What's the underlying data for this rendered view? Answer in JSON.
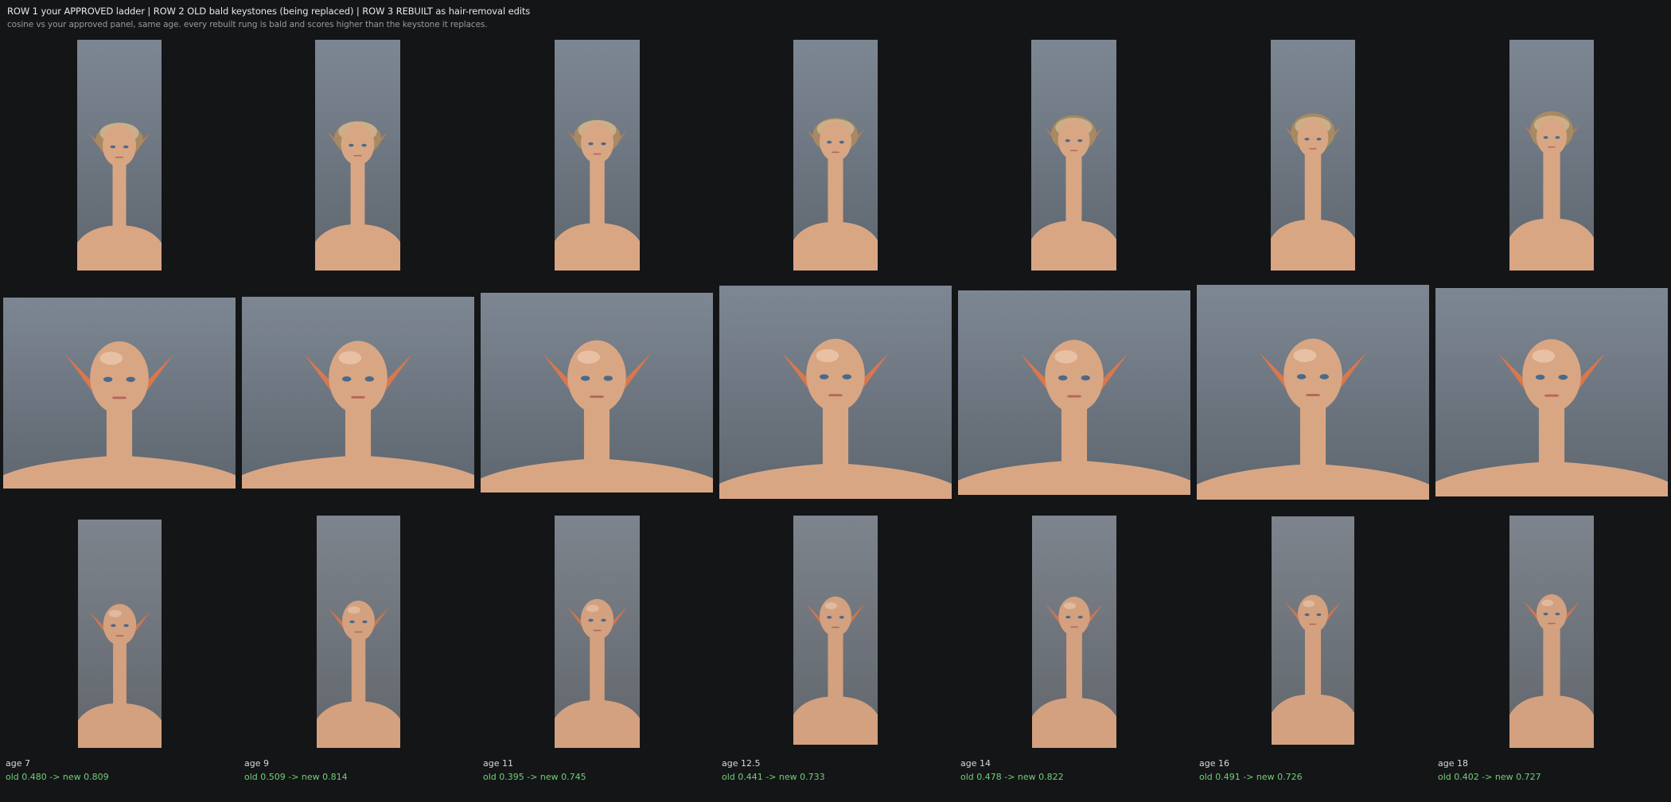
{
  "header": {
    "title": "ROW 1 your APPROVED ladder   |   ROW 2 OLD bald keystones (being replaced)   |   ROW 3 REBUILT as hair-removal edits",
    "subtitle": "cosine vs your approved panel, same age. every rebuilt rung is bald and scores higher than the keystone it replaces."
  },
  "colors": {
    "background": "#141517",
    "score_text": "#6fd078",
    "portrait_bg": "#737c87",
    "skin": "#d9a684",
    "hair": "#a78a62",
    "ear": "#d9774d"
  },
  "icons": {
    "approved": "portrait-curly-hair-elf-image",
    "old": "portrait-bald-elf-image",
    "rebuilt": "portrait-bald-edit-image"
  },
  "columns": [
    {
      "age_label": "age 7",
      "score_label": "old 0.480  ->  new 0.809"
    },
    {
      "age_label": "age 9",
      "score_label": "old 0.509  ->  new 0.814"
    },
    {
      "age_label": "age 11",
      "score_label": "old 0.395  ->  new 0.745"
    },
    {
      "age_label": "age 12.5",
      "score_label": "old 0.441  ->  new 0.733"
    },
    {
      "age_label": "age 14",
      "score_label": "old 0.478  ->  new 0.822"
    },
    {
      "age_label": "age 16",
      "score_label": "old 0.491  ->  new 0.726"
    },
    {
      "age_label": "age 18",
      "score_label": "old 0.402  ->  new 0.727"
    }
  ]
}
